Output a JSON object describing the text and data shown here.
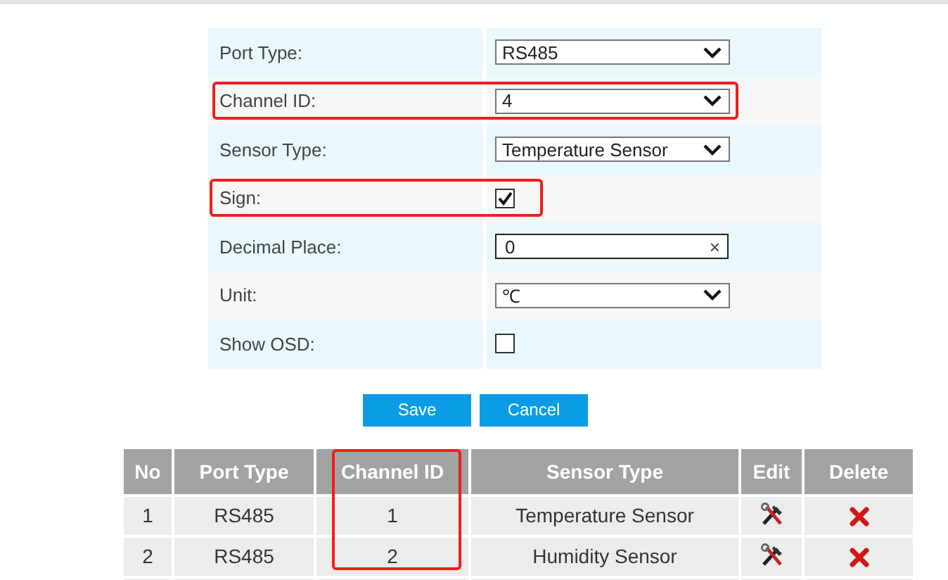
{
  "form": {
    "rows": [
      {
        "label": "Port Type:",
        "kind": "select",
        "value": "RS485",
        "highlighted": false
      },
      {
        "label": "Channel ID:",
        "kind": "select",
        "value": "4",
        "highlighted": true
      },
      {
        "label": "Sensor Type:",
        "kind": "select",
        "value": "Temperature Sensor",
        "highlighted": false
      },
      {
        "label": "Sign:",
        "kind": "checkbox",
        "checked": true,
        "highlighted": true
      },
      {
        "label": "Decimal Place:",
        "kind": "input",
        "value": "0",
        "clear_icon": "×",
        "highlighted": false
      },
      {
        "label": "Unit:",
        "kind": "select",
        "value": "℃",
        "highlighted": false
      },
      {
        "label": "Show OSD:",
        "kind": "checkbox",
        "checked": false,
        "highlighted": false
      }
    ]
  },
  "buttons": [
    "Save",
    "Cancel"
  ],
  "table": {
    "columns": [
      {
        "label": "No",
        "highlighted": false
      },
      {
        "label": "Port Type",
        "highlighted": false
      },
      {
        "label": "Channel ID",
        "highlighted": true
      },
      {
        "label": "Sensor Type",
        "highlighted": false
      },
      {
        "label": "Edit",
        "highlighted": false
      },
      {
        "label": "Delete",
        "highlighted": false
      }
    ],
    "rows": [
      {
        "no": "1",
        "port_type": "RS485",
        "channel_id": "1",
        "sensor_type": "Temperature Sensor"
      },
      {
        "no": "2",
        "port_type": "RS485",
        "channel_id": "2",
        "sensor_type": "Humidity Sensor"
      }
    ]
  }
}
